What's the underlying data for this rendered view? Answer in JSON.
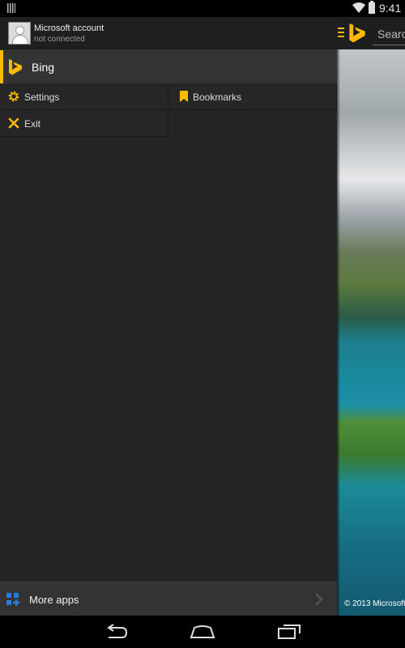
{
  "status_bar": {
    "time": "9:41"
  },
  "account": {
    "name": "Microsoft account",
    "status": "not connected"
  },
  "drawer": {
    "active_item": {
      "label": "Bing"
    },
    "grid": [
      [
        {
          "label": "Settings",
          "icon": "gear-icon"
        },
        {
          "label": "Bookmarks",
          "icon": "bookmark-icon"
        }
      ],
      [
        {
          "label": "Exit",
          "icon": "close-icon"
        }
      ]
    ],
    "more_apps": {
      "label": "More apps",
      "icon": "apps-grid-icon"
    }
  },
  "main": {
    "search": {
      "placeholder": "Search"
    },
    "copyright": "© 2013 Microsoft"
  },
  "colors": {
    "accent": "#ffb900",
    "drawer_bg": "#252525",
    "item_bg": "#333333",
    "apps_blue": "#2a7de1"
  }
}
